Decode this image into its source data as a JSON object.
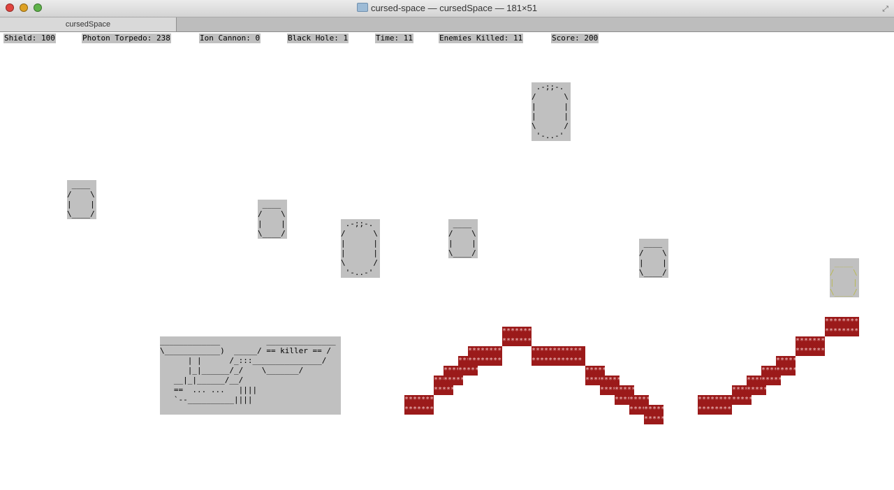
{
  "window": {
    "title": "cursed-space — cursedSpace — 181×51",
    "tab": "cursedSpace"
  },
  "status": {
    "shield": "Shield: 100",
    "photon": "Photon Torpedo: 238",
    "ion": "Ion Cannon: 0",
    "blackhole": "Black Hole: 1",
    "time": "Time: 11",
    "kills": "Enemies Killed: 11",
    "score": "Score: 200"
  },
  "sprites": {
    "asteroid_small": " ____\n/    \\\n|    |\n\\____/",
    "asteroid_large": " .-;;-.\n/      \\\n|      |\n|      |\n\\      /\n '-..-'"
  },
  "ship": {
    "art": "_____________          _______________\n\\____________)  _____/ == killer == /\n      | |      /_:::_______________/\n      |_|______/_/    \\_______/\n   __|_|______/__/\n   ==  ... ...   ||||\n   `--__________||||"
  },
  "colors": {
    "terrain": "#9b1a1a",
    "sprite_bg": "#c0c0c0",
    "enemy_tinted": "#b8b850"
  }
}
